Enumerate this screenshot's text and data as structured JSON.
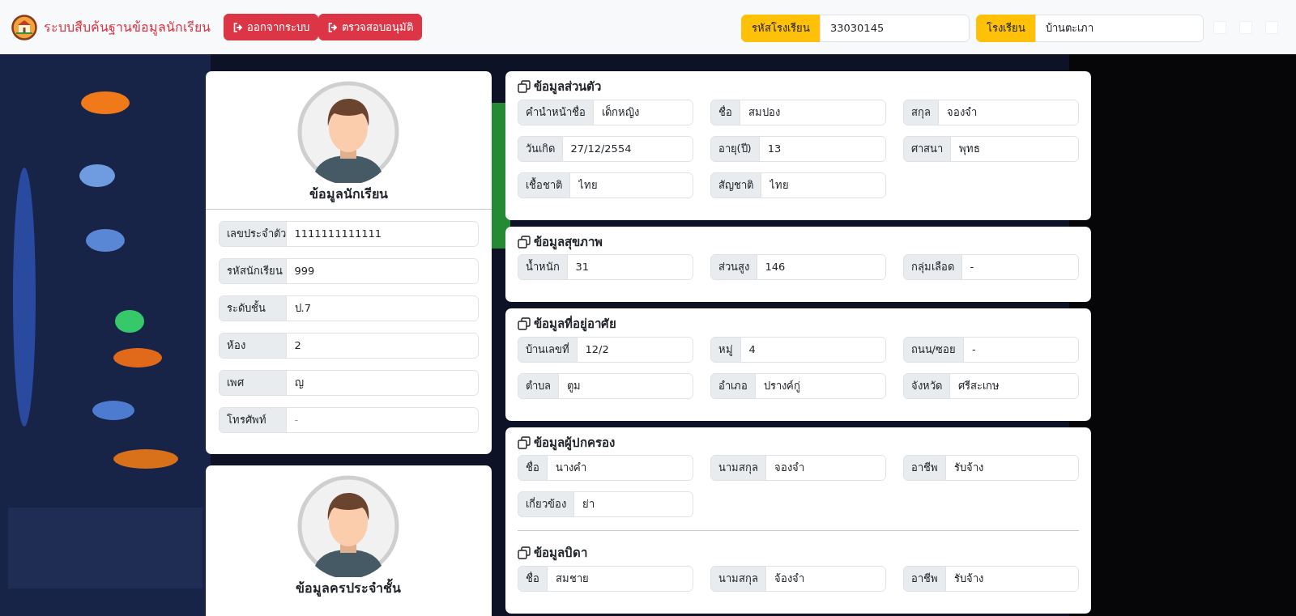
{
  "header": {
    "title": "ระบบสืบค้นฐานข้อมูลนักเรียน",
    "buttons": [
      {
        "label": "ออกจากระบบ"
      },
      {
        "label": "ตรวจสอบอนุมัติ"
      }
    ],
    "fields": [
      {
        "label": "รหัสโรงเรียน",
        "value": "33030145"
      },
      {
        "label": "โรงเรียน",
        "value": "บ้านตะเภา"
      }
    ]
  },
  "profile_cards": [
    {
      "title": "ข้อมูลนักเรียน",
      "fields": [
        {
          "label": "เลขประจำตัว",
          "value": "1111111111111"
        },
        {
          "label": "รหัสนักเรียน",
          "value": "999"
        },
        {
          "label": "ระดับชั้น",
          "value": "ป.7"
        },
        {
          "label": "ห้อง",
          "value": "2"
        },
        {
          "label": "เพศ",
          "value": "ญ"
        },
        {
          "label": "โทรศัพท์",
          "placeholder": "-"
        }
      ]
    },
    {
      "title": "ข้อมูลครประจำชั้น"
    }
  ],
  "info_cards": [
    {
      "groups": [
        {
          "title": "ข้อมูลส่วนตัว",
          "fields": [
            {
              "label": "คำนำหน้าชื่อ",
              "value": "เด็กหญิง"
            },
            {
              "label": "ชื่อ",
              "value": "สมปอง"
            },
            {
              "label": "สกุล",
              "value": "จองจำ"
            },
            {
              "label": "วันเกิด",
              "value": "27/12/2554"
            },
            {
              "label": "อายุ(ปี)",
              "value": "13"
            },
            {
              "label": "ศาสนา",
              "value": "พุทธ"
            },
            {
              "label": "เชื้อชาติ",
              "value": "ไทย"
            },
            {
              "label": "สัญชาติ",
              "value": "ไทย"
            }
          ]
        }
      ]
    },
    {
      "groups": [
        {
          "title": "ข้อมูลสุขภาพ",
          "fields": [
            {
              "label": "น้ำหนัก",
              "value": "31"
            },
            {
              "label": "ส่วนสูง",
              "value": "146"
            },
            {
              "label": "กลุ่มเลือด",
              "value": "-"
            }
          ]
        }
      ]
    },
    {
      "groups": [
        {
          "title": "ข้อมูลที่อยู่อาศัย",
          "fields": [
            {
              "label": "บ้านเลขที่",
              "value": "12/2"
            },
            {
              "label": "หมู่",
              "value": "4"
            },
            {
              "label": "ถนน/ซอย",
              "value": "-"
            },
            {
              "label": "ตำบล",
              "value": "ตูม"
            },
            {
              "label": "อำเภอ",
              "value": "ปรางค์กู่"
            },
            {
              "label": "จังหวัด",
              "value": "ศรีสะเกษ"
            }
          ]
        }
      ]
    },
    {
      "groups": [
        {
          "title": "ข้อมูลผู้ปกครอง",
          "fields": [
            {
              "label": "ชื่อ",
              "value": "นางคำ"
            },
            {
              "label": "นามสกุล",
              "value": "จองจำ"
            },
            {
              "label": "อาชีพ",
              "value": "รับจ้าง"
            },
            {
              "label": "เกี่ยวข้อง",
              "value": "ย่า"
            }
          ]
        },
        {
          "title": "ข้อมูลบิดา",
          "fields": [
            {
              "label": "ชื่อ",
              "value": "สมชาย"
            },
            {
              "label": "นามสกุล",
              "value": "จ้องจำ"
            },
            {
              "label": "อาชีพ",
              "value": "รับจ้าง"
            }
          ]
        }
      ]
    }
  ]
}
